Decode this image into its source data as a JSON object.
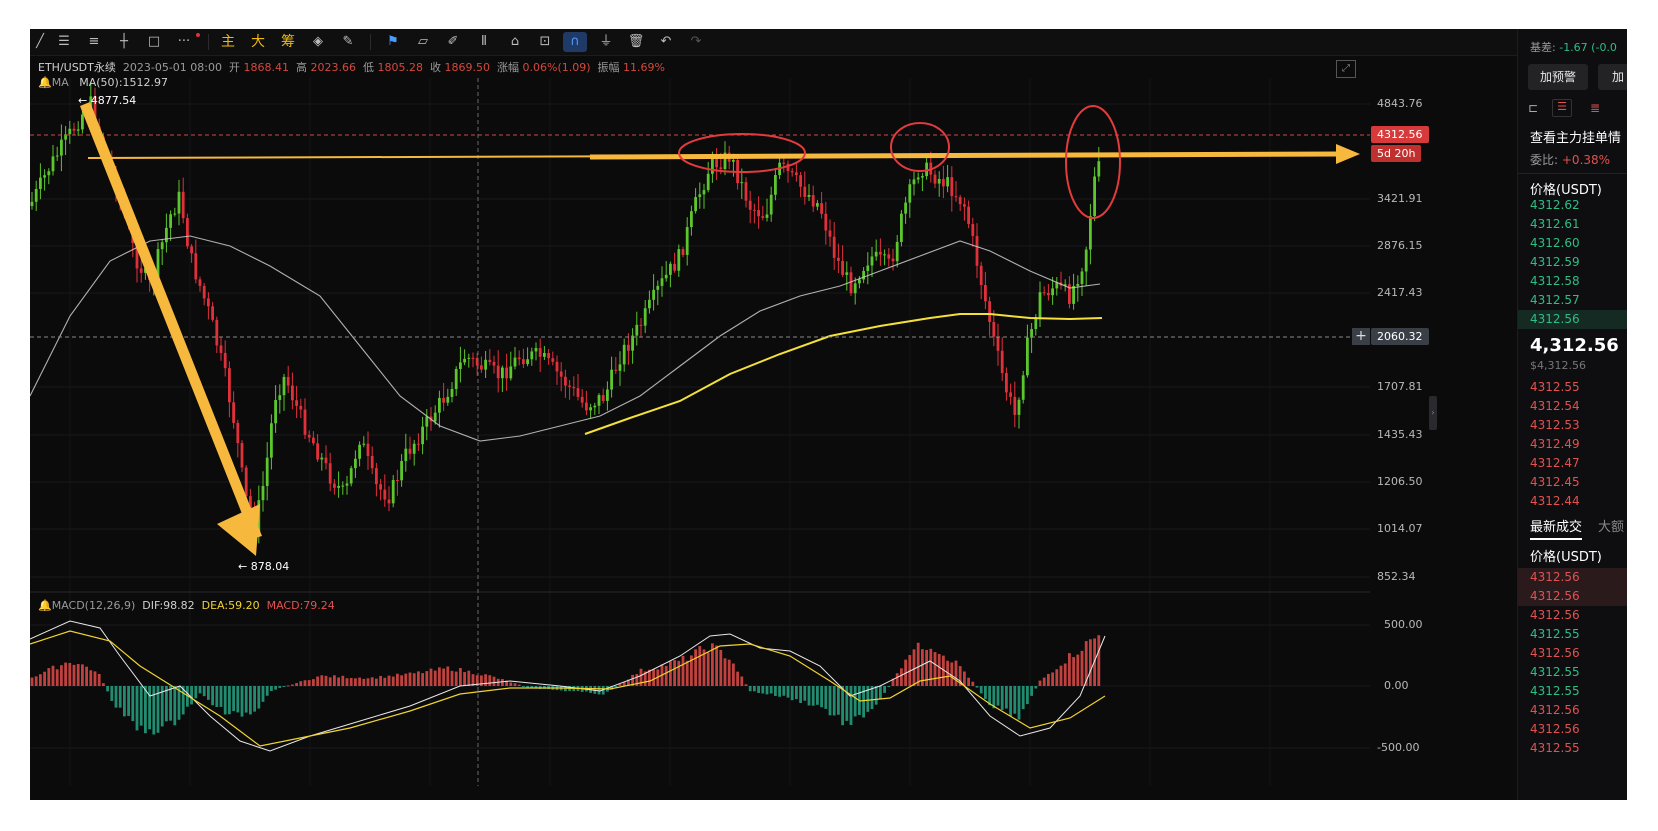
{
  "toolbar": {
    "cn_buttons": [
      "主",
      "大",
      "筹"
    ],
    "icons": [
      "draw-line-icon",
      "parallel-line-icon",
      "fib-icon",
      "horizontal-line-icon",
      "rectangle-icon",
      "more-icon",
      "drawings-icon",
      "ruler-icon",
      "pencil-icon",
      "pattern-icon",
      "lock-icon",
      "measure-icon",
      "magnet-icon",
      "filter-icon",
      "trash-icon",
      "undo-icon",
      "redo-icon"
    ]
  },
  "header": {
    "symbol": "ETH/USDT永续",
    "time": "2023-05-01 08:00",
    "open_label": "开",
    "open": "1868.41",
    "high_label": "高",
    "high": "2023.66",
    "low_label": "低",
    "low": "1805.28",
    "close_label": "收",
    "close": "1869.50",
    "change_label": "涨幅",
    "change": "0.06%(1.09)",
    "amp_label": "振幅",
    "amp": "11.69%",
    "ma_label": "MA",
    "ma50": "MA(50):1512.97"
  },
  "macd_header": {
    "label": "MACD(12,26,9)",
    "dif": "DIF:98.82",
    "dea": "DEA:59.20",
    "macd": "MACD:79.24"
  },
  "annotations": {
    "high_marker": "4877.54",
    "low_marker": "878.04"
  },
  "axis": {
    "price_ticks": [
      "4843.76",
      "3421.91",
      "2876.15",
      "2417.43",
      "1707.81",
      "1435.43",
      "1206.50",
      "1014.07",
      "852.34"
    ],
    "macd_ticks": [
      "500.00",
      "0.00",
      "-500.00"
    ],
    "current_price_tag": "4312.56",
    "countdown_tag": "5d 20h",
    "crosshair_price_tag": "2060.32"
  },
  "right_panel": {
    "basis_label": "基差:",
    "basis_value": "-1.67 (-0.0",
    "alert_button": "加预警",
    "alert_button2": "加",
    "orderbook_title": "查看主力挂单情",
    "ratio_label": "委比:",
    "ratio_value": "+0.38%",
    "price_header": "价格(USDT)",
    "bids": [
      "4312.62",
      "4312.61",
      "4312.60",
      "4312.59",
      "4312.58",
      "4312.57",
      "4312.56"
    ],
    "last_price": "4,312.56",
    "last_price_usd": "$4,312.56",
    "asks": [
      "4312.55",
      "4312.54",
      "4312.53",
      "4312.49",
      "4312.47",
      "4312.45",
      "4312.44"
    ],
    "trades_tab": "最新成交",
    "trades_tab2": "大额",
    "trades_header": "价格(USDT)",
    "trades": [
      {
        "p": "4312.56",
        "c": "#e05151"
      },
      {
        "p": "4312.56",
        "c": "#e05151"
      },
      {
        "p": "4312.56",
        "c": "#e05151"
      },
      {
        "p": "4312.55",
        "c": "#2ebd85"
      },
      {
        "p": "4312.56",
        "c": "#e05151"
      },
      {
        "p": "4312.55",
        "c": "#2ebd85"
      },
      {
        "p": "4312.55",
        "c": "#2ebd85"
      },
      {
        "p": "4312.56",
        "c": "#e05151"
      },
      {
        "p": "4312.56",
        "c": "#e05151"
      },
      {
        "p": "4312.55",
        "c": "#e05151"
      }
    ]
  },
  "colors": {
    "up": "#5bc62d",
    "down": "#e0303a",
    "ma_fast": "#cfcfcf",
    "ma_slow": "#f3e03b",
    "arrow": "#f7b93d",
    "circle": "#e23b3b",
    "bid": "#2ebd85",
    "ask": "#e05151"
  }
}
